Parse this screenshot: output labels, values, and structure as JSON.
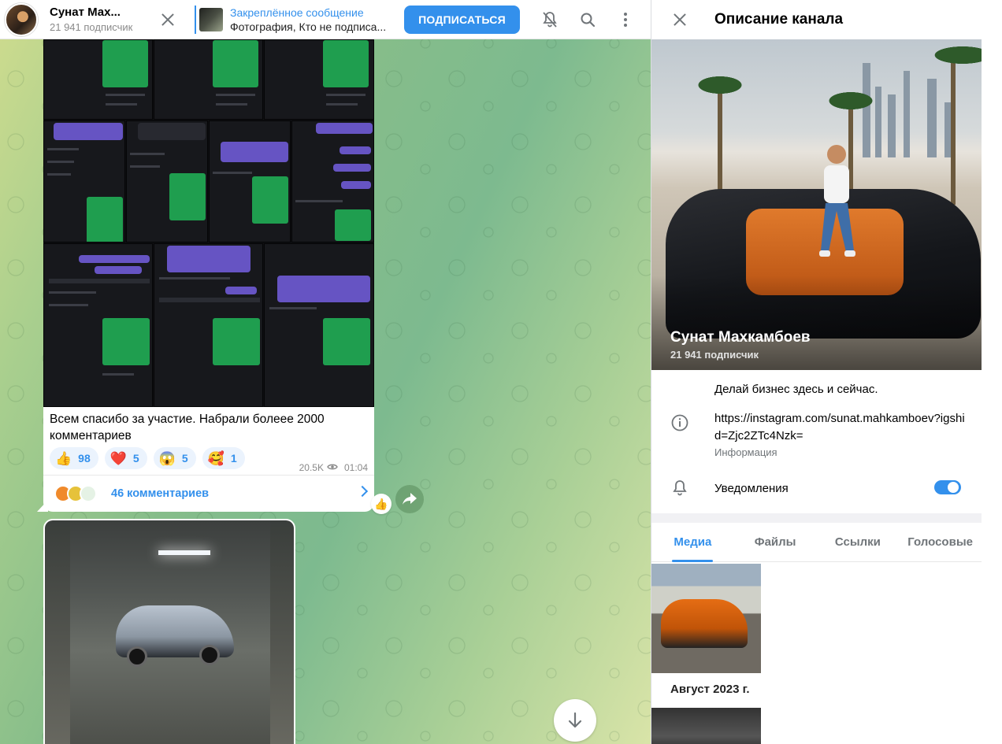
{
  "header": {
    "channel_name": "Сунат Мах...",
    "subscribers": "21 941 подписчик",
    "pinned_title": "Закреплённое сообщение",
    "pinned_text": "Фотография, Кто не подписа...",
    "subscribe_label": "ПОДПИСАТЬСЯ"
  },
  "post": {
    "caption": "Всем спасибо за участие. Набрали болеее 2000 комментариев",
    "reactions": [
      {
        "emoji": "👍",
        "count": "98"
      },
      {
        "emoji": "❤️",
        "count": "5"
      },
      {
        "emoji": "😱",
        "count": "5"
      },
      {
        "emoji": "🥰",
        "count": "1"
      }
    ],
    "views": "20.5K",
    "time": "01:04",
    "comments": "46 комментариев",
    "floating_reaction": "👍"
  },
  "panel": {
    "title": "Описание канала",
    "name": "Сунат Махкамбоев",
    "subscribers": "21 941 подписчик",
    "description": "Делай бизнес здесь и сейчас.",
    "link": "https://instagram.com/sunat.mahkamboev?igshid=Zjc2ZTc4Nzk=",
    "link_label": "Информация",
    "notifications_label": "Уведомления",
    "notifications_on": true,
    "tabs": [
      "Медиа",
      "Файлы",
      "Ссылки",
      "Голосовые"
    ],
    "active_tab": "Медиа",
    "media_month": "Август 2023 г."
  },
  "colors": {
    "accent": "#3390ec",
    "secondary_text": "#707579"
  }
}
